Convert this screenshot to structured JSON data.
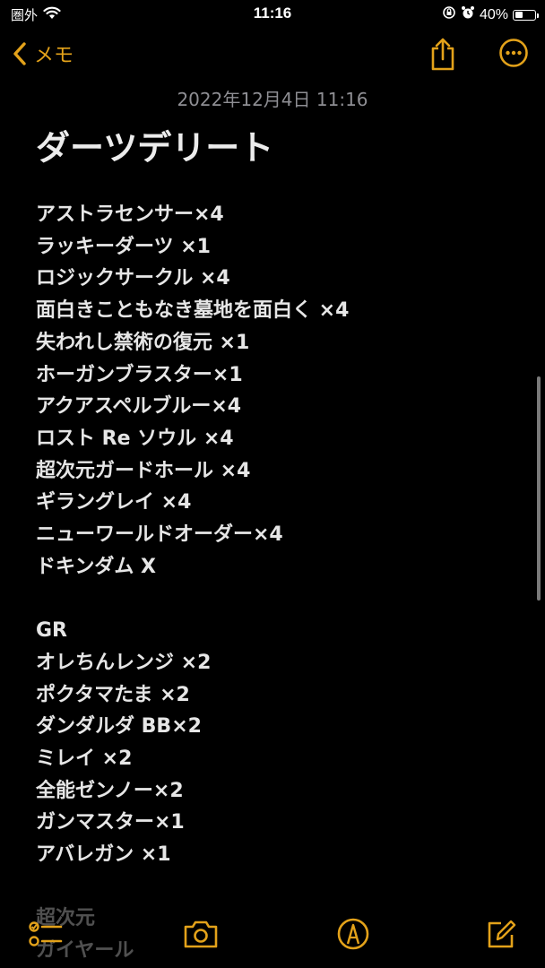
{
  "status_bar": {
    "carrier": "圏外",
    "time": "11:16",
    "battery_percent": "40%",
    "battery_level": 0.4
  },
  "nav": {
    "back_label": "メモ",
    "accent_color": "#e3a21a"
  },
  "note": {
    "date": "2022年12月4日 11:16",
    "title": "ダーツデリート",
    "lines": [
      "アストラセンサー×4",
      "ラッキーダーツ ×1",
      "ロジックサークル ×4",
      "面白きこともなき墓地を面白く ×4",
      "失われし禁術の復元 ×1",
      "ホーガンブラスター×1",
      "アクアスペルブルー×4",
      "ロスト Re ソウル ×4",
      "超次元ガードホール ×4",
      "ギラングレイ ×4",
      "ニューワールドオーダー×4",
      "ドキンダム X",
      "",
      "GR",
      "オレちんレンジ ×2",
      "ポクタマたま ×2",
      "ダンダルダ BB×2",
      "ミレイ ×2",
      "全能ゼンノー×2",
      "ガンマスター×1",
      "アバレガン ×1",
      "",
      "超次元",
      "ガイヤール"
    ]
  },
  "icons": {
    "share": "share-icon",
    "more": "more-icon",
    "checklist": "checklist-icon",
    "camera": "camera-icon",
    "markup": "markup-icon",
    "compose": "compose-icon"
  }
}
